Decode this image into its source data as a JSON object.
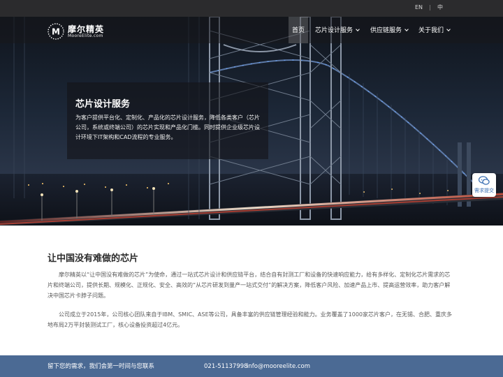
{
  "lang_bar": {
    "en": "EN",
    "separator": "|",
    "zh": "中"
  },
  "logo": {
    "cn": "摩尔精英",
    "en": "MooreElite.com",
    "mark": "M"
  },
  "nav": {
    "home": "首页",
    "chip_design": "芯片设计服务",
    "supply_chain": "供应链服务",
    "about": "关于我们"
  },
  "hero": {
    "title": "芯片设计服务",
    "description": "为客户提供平台化、定制化、产品化的芯片设计服务，降低各类客户（芯片公司，系统或终端公司）的芯片实现和产品化门槛。同时提供企业级芯片设计环境下IT架构和CAD流程的专业服务。"
  },
  "feedback": {
    "label": "需求提交",
    "icon": "chat-bubbles-icon"
  },
  "main": {
    "title": "让中国没有难做的芯片",
    "para1": "摩尔精英以“让中国没有难做的芯片”为使命，通过一站式芯片设计和供应链平台，结合自有封测工厂和设备的快速响应能力，给有多样化、定制化芯片需求的芯片和终端公司，提供长期、规模化、正规化、安全、高效的“从芯片研发到量产一站式交付”的解决方案，降低客户风险、加速产品上市、提高运营效率，助力客户解决中国芯片卡脖子问题。",
    "para2": "公司成立于2015年，公司核心团队来自于IBM、SMIC、ASE等公司，具备丰富的供应链管理经验和能力。业务覆盖了1000家芯片客户，在无锡、合肥、重庆多地布局2万平封装测试工厂，核心设备投资超过4亿元。"
  },
  "footer": {
    "message": "留下您的需求，我们会第一时间与您联系",
    "phone": "021-51137998",
    "email": "info@mooreelite.com"
  },
  "colors": {
    "footer_bg": "#4b6a94",
    "topbar_bg": "#2b2b2d",
    "accent": "#3a6fb3"
  }
}
